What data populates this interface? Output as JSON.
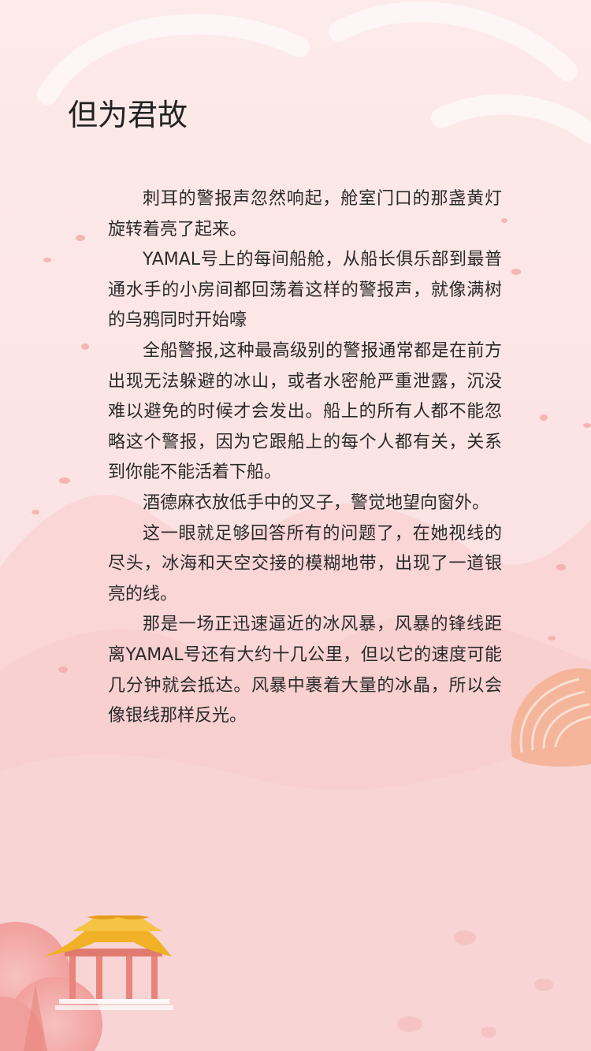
{
  "article": {
    "title": "但为君故",
    "paragraphs": [
      "刺耳的警报声忽然响起，舱室门口的那盏黄灯旋转着亮了起来。",
      "YAMAL号上的每间船舱，从船长俱乐部到最普通水手的小房间都回荡着这样的警报声，就像满树的乌鸦同时开始嚎",
      "全船警报,这种最高级别的警报通常都是在前方出现无法躲避的冰山，或者水密舱严重泄露，沉没难以避免的时候才会发出。船上的所有人都不能忽略这个警报，因为它跟船上的每个人都有关，关系到你能不能活着下船。",
      "酒德麻衣放低手中的叉子，警觉地望向窗外。",
      "这一眼就足够回答所有的问题了，在她视线的尽头，冰海和天空交接的模糊地带，出现了一道银亮的线。",
      "那是一场正迅速逼近的冰风暴，风暴的锋线距离YAMAL号还有大约十几公里，但以它的速度可能几分钟就会抵达。风暴中裹着大量的冰晶，所以会像银线那样反光。"
    ]
  },
  "theme": {
    "background": "#fde6e6",
    "text": "#2a2a2a",
    "roof": "#f0b126",
    "pillar": "#e8857a",
    "tree": "#f2a8a4"
  }
}
